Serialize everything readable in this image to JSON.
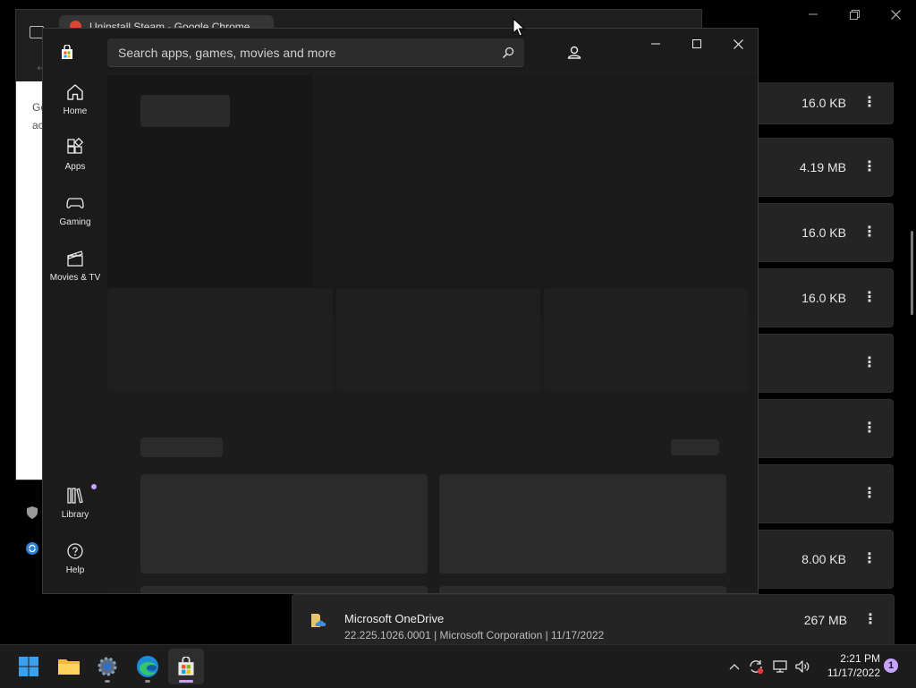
{
  "chrome": {
    "tab_title": "Uninstall Steam - Google Chrome",
    "snippet_line1": "Go",
    "snippet_line2": "ac"
  },
  "settings_window": {
    "rows": [
      {
        "size": "16.0 KB"
      },
      {
        "size": "4.19 MB"
      },
      {
        "size": "16.0 KB"
      },
      {
        "size": "16.0 KB"
      },
      {
        "size": ""
      },
      {
        "size": ""
      },
      {
        "size": ""
      },
      {
        "size": "8.00 KB"
      }
    ],
    "more_glyph": "⋮",
    "onedrive": {
      "name": "Microsoft OneDrive",
      "meta": "22.225.1026.0001 | Microsoft Corporation | 11/17/2022",
      "size": "267 MB"
    }
  },
  "store": {
    "search_placeholder": "Search apps, games, movies and more",
    "nav": {
      "home": "Home",
      "apps": "Apps",
      "gaming": "Gaming",
      "movies": "Movies & TV",
      "library": "Library",
      "help": "Help"
    }
  },
  "taskbar": {
    "time": "2:21 PM",
    "date": "11/17/2022",
    "notification_count": "1"
  },
  "icons": {
    "store_window": [
      "store-icon",
      "search-icon",
      "account-icon",
      "minimize-icon",
      "maximize-icon",
      "close-icon"
    ],
    "nav": [
      "home-icon",
      "apps-icon",
      "gaming-icon",
      "movies-tv-icon",
      "library-icon",
      "help-icon"
    ],
    "taskbar": [
      "windows-start-icon",
      "file-explorer-icon",
      "settings-icon",
      "edge-icon",
      "store-icon"
    ],
    "tray": [
      "chevron-up-icon",
      "sync-icon",
      "network-icon",
      "volume-icon"
    ]
  },
  "colors": {
    "accent": "#c7a2ff",
    "store_bg": "#1b1b1b",
    "placeholder": "#2b2b2b",
    "taskbar": "#1c1c1c"
  }
}
